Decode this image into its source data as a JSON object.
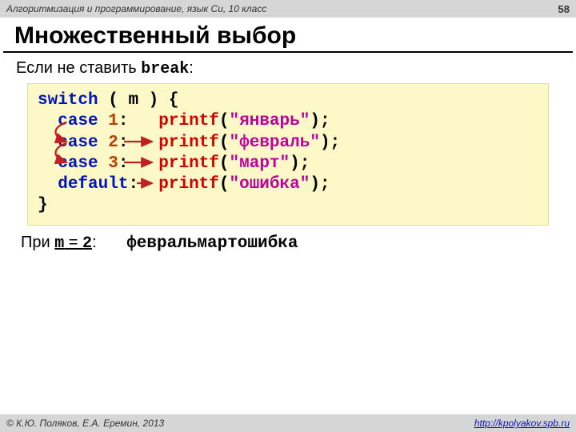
{
  "header": {
    "course": "Алгоритмизация и программирование, язык Си, 10 класс",
    "page": "58"
  },
  "title": "Множественный выбор",
  "sub": {
    "prefix": "Если не ставить ",
    "kw": "break",
    "suffix": ":"
  },
  "code": {
    "switch": "switch",
    "lpar": "( ",
    "var": "m",
    "rpar": " )",
    "lbrace": " {",
    "case": "case",
    "n1": "1",
    "n2": "2",
    "n3": "3",
    "colon": ":",
    "default": "default",
    "printf": "printf",
    "s1": "\"январь\"",
    "s2": "\"февраль\"",
    "s3": "\"март\"",
    "s4": "\"ошибка\"",
    "closep": ");",
    "rbrace": "}"
  },
  "when": {
    "prefix": "При ",
    "expr_l": "m",
    "expr_eq": " = ",
    "expr_r": "2",
    "suffix": ":",
    "output": "февральмартошибка"
  },
  "footer": {
    "copyright": "© К.Ю. Поляков, Е.А. Еремин, 2013",
    "url": "http://kpolyakov.spb.ru"
  }
}
